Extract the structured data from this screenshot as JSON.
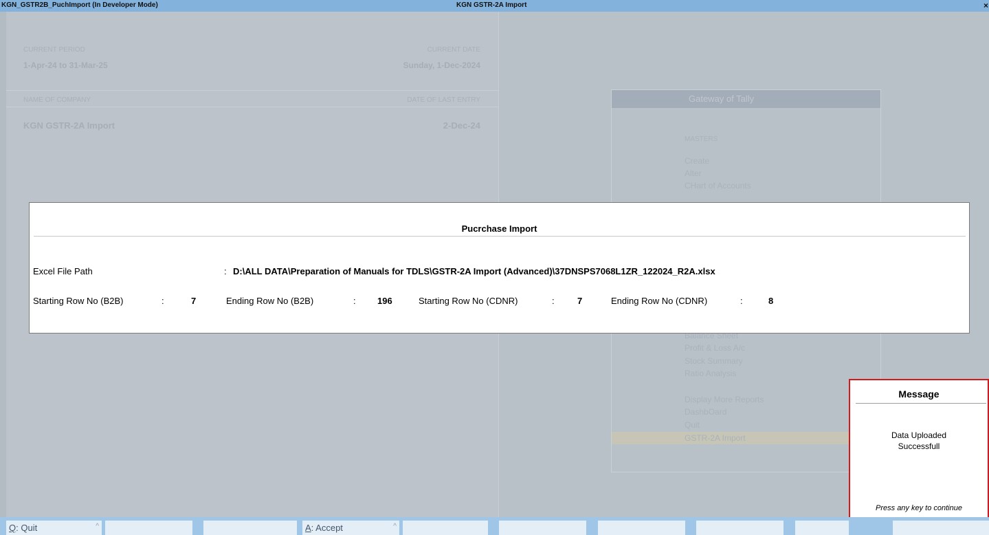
{
  "window": {
    "title_left": "KGN_GSTR2B_PuchImport (In Developer Mode)",
    "title_center": "KGN GSTR-2A Import",
    "close_glyph": "×"
  },
  "background": {
    "current_period_label": "CURRENT PERIOD",
    "current_period_value": "1-Apr-24 to 31-Mar-25",
    "current_date_label": "CURRENT DATE",
    "current_date_value": "Sunday, 1-Dec-2024",
    "company_label": "NAME OF COMPANY",
    "last_entry_label": "DATE OF LAST ENTRY",
    "company_value": "KGN GSTR-2A Import",
    "last_entry_value": "2-Dec-24"
  },
  "gateway": {
    "title": "Gateway of Tally",
    "masters_label": "MASTERS",
    "items_top": [
      "Create",
      "Alter",
      "CHart of Accounts"
    ],
    "items_reports": [
      "Balance Sheet",
      "Profit & Loss A/c",
      "Stock Summary",
      "Ratio Analysis"
    ],
    "items_more": [
      "Display More Reports",
      "DashbOard",
      "Quit",
      "GSTR-2A Import"
    ]
  },
  "modal": {
    "title": "Pucrchase Import",
    "excel_path_label": "Excel File Path",
    "excel_path_sep": ":",
    "excel_path_value": "D:\\ALL DATA\\Preparation of Manuals for TDLS\\GSTR-2A Import (Advanced)\\37DNSPS7068L1ZR_122024_R2A.xlsx",
    "start_b2b_label": "Starting Row No (B2B)",
    "start_b2b_value": "7",
    "end_b2b_label": "Ending Row No (B2B)",
    "end_b2b_value": "196",
    "start_cdnr_label": "Starting Row No (CDNR)",
    "start_cdnr_value": "7",
    "end_cdnr_label": "Ending Row No (CDNR)",
    "end_cdnr_value": "8",
    "sep": ":"
  },
  "message": {
    "title": "Message",
    "line1": "Data Uploaded",
    "line2": "Successfull",
    "footer": "Press any key to continue"
  },
  "bottombar": {
    "quit_key": "Q",
    "quit_label": ": Quit",
    "accept_key": "A",
    "accept_label": ": Accept",
    "caret": "^"
  },
  "colors": {
    "titlebar": "#83b3dc",
    "message_border": "#d9171b",
    "bottombar": "#9fc6e7"
  }
}
